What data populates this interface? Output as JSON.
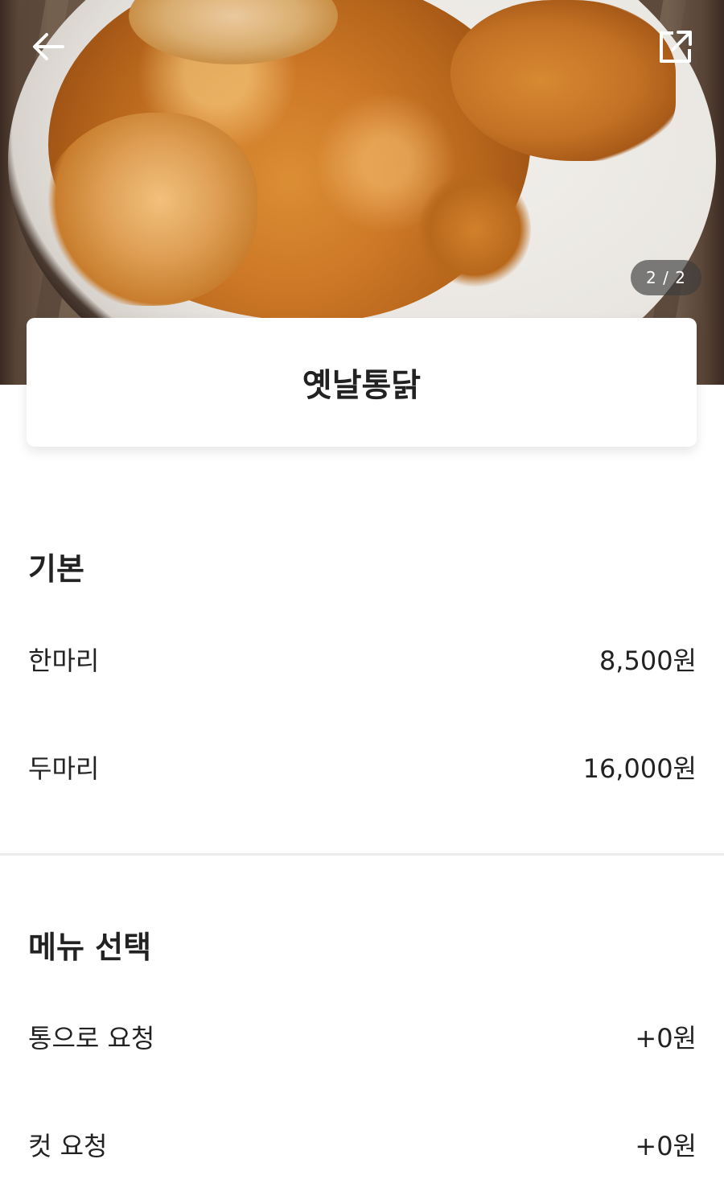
{
  "header": {
    "back_icon": "arrow-left-icon",
    "share_icon": "share-external-icon",
    "page_indicator": "2 / 2"
  },
  "menu_title": "옛날통닭",
  "sections": [
    {
      "title": "기본",
      "items": [
        {
          "label": "한마리",
          "price": "8,500원"
        },
        {
          "label": "두마리",
          "price": "16,000원"
        }
      ]
    },
    {
      "title": "메뉴 선택",
      "items": [
        {
          "label": "통으로 요청",
          "price": "+0원"
        },
        {
          "label": "컷 요청",
          "price": "+0원"
        }
      ]
    }
  ]
}
